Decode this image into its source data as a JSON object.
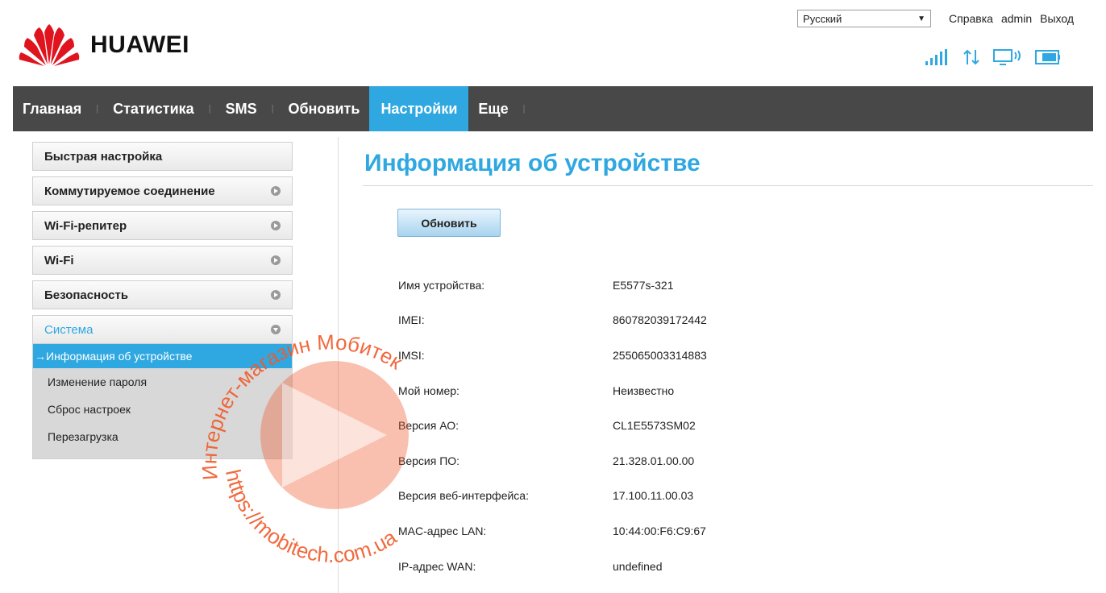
{
  "header": {
    "brand": "HUAWEI",
    "language": {
      "selected": "Русский"
    },
    "links": {
      "help": "Справка",
      "user": "admin",
      "logout": "Выход"
    },
    "status_icons": [
      "signal-icon",
      "data-transfer-icon",
      "wifi-device-icon",
      "battery-icon"
    ]
  },
  "nav": {
    "items": [
      {
        "label": "Главная"
      },
      {
        "label": "Статистика"
      },
      {
        "label": "SMS"
      },
      {
        "label": "Обновить"
      },
      {
        "label": "Настройки",
        "active": true
      },
      {
        "label": "Еще"
      }
    ]
  },
  "sidebar": {
    "items": [
      {
        "label": "Быстрая настройка"
      },
      {
        "label": "Коммутируемое соединение"
      },
      {
        "label": "Wi-Fi-репитер"
      },
      {
        "label": "Wi-Fi"
      },
      {
        "label": "Безопасность"
      },
      {
        "label": "Система"
      }
    ],
    "system_submenu": [
      {
        "label": "Информация об устройстве",
        "active": true,
        "prefix": "→"
      },
      {
        "label": "Изменение пароля"
      },
      {
        "label": "Сброс настроек"
      },
      {
        "label": "Перезагрузка"
      }
    ]
  },
  "main": {
    "title": "Информация об устройстве",
    "refresh_label": "Обновить",
    "rows": [
      {
        "label": "Имя устройства:",
        "value": "E5577s-321"
      },
      {
        "label": "IMEI:",
        "value": "860782039172442"
      },
      {
        "label": "IMSI:",
        "value": "255065003314883"
      },
      {
        "label": "Мой номер:",
        "value": "Неизвестно"
      },
      {
        "label": "Версия АО:",
        "value": "CL1E5573SM02"
      },
      {
        "label": "Версия ПО:",
        "value": "21.328.01.00.00"
      },
      {
        "label": "Версия веб-интерфейса:",
        "value": "17.100.11.00.03"
      },
      {
        "label": "MAC-адрес LAN:",
        "value": "10:44:00:F6:C9:67"
      },
      {
        "label": "IP-адрес WAN:",
        "value": "undefined"
      }
    ]
  },
  "watermark": {
    "text_top": "Интернет-магазин Мобитек",
    "text_bottom": "https://mobitech.com.ua"
  },
  "colors": {
    "accent": "#2fa8e1",
    "navbar": "#484848",
    "brand_red": "#e0141e",
    "watermark": "#f05a2a"
  }
}
